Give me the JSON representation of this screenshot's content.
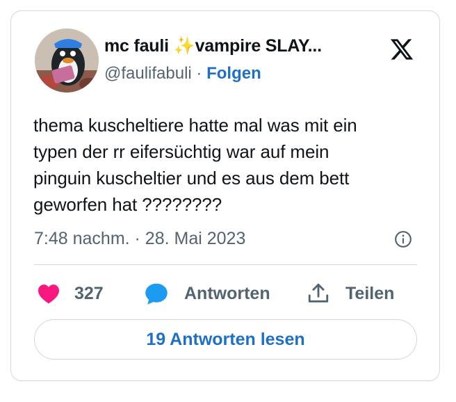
{
  "author": {
    "display_name_part1": "mc fauli",
    "sparkle_emoji": "✨",
    "display_name_part2": "vampire SLAY...",
    "handle": "@faulifabuli",
    "separator": " · ",
    "follow_label": "Folgen"
  },
  "tweet": {
    "text": "thema kuscheltiere hatte mal was mit ein\ntypen der rr eifersüchtig war auf mein\npinguin kuscheltier und es aus dem bett\ngeworfen hat ????????",
    "timestamp": "7:48 nachm. · 28. Mai 2023"
  },
  "actions": {
    "like_count": "327",
    "reply_label": "Antworten",
    "share_label": "Teilen",
    "read_replies_label": "19 Antworten lesen"
  },
  "colors": {
    "like": "#f91880",
    "reply": "#1d9bf0",
    "link": "#1d70c4",
    "muted": "#536471",
    "border": "#cfd9de"
  },
  "icons": [
    "x-logo-icon",
    "info-icon",
    "heart-icon",
    "reply-bubble-icon",
    "share-icon",
    "sparkle-emoji"
  ]
}
